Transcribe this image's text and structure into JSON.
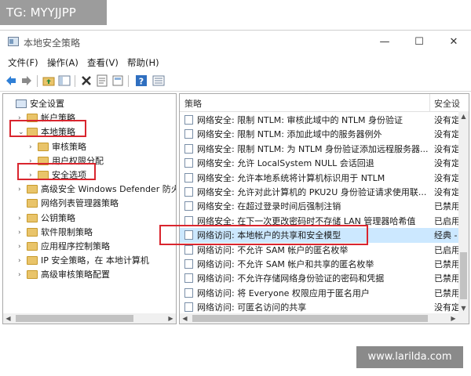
{
  "watermark_top": "TG: MYYJJPP",
  "watermark_bottom": "www.larilda.com",
  "window": {
    "title": "本地安全策略",
    "controls": {
      "minimize": "—",
      "maximize": "☐",
      "close": "✕"
    }
  },
  "menu": {
    "items": [
      {
        "label": "文件(F)"
      },
      {
        "label": "操作(A)"
      },
      {
        "label": "查看(V)"
      },
      {
        "label": "帮助(H)"
      }
    ]
  },
  "toolbar": {
    "icons": [
      "back-icon",
      "forward-icon",
      "folder-up-icon",
      "console-tree-icon",
      "delete-icon",
      "properties-icon",
      "export-icon",
      "help-icon",
      "view-icon"
    ]
  },
  "tree": {
    "items": [
      {
        "label": "安全设置",
        "level": 0,
        "expander": ""
      },
      {
        "label": "帐户策略",
        "level": 1,
        "expander": "›"
      },
      {
        "label": "本地策略",
        "level": 1,
        "expander": "⌄"
      },
      {
        "label": "审核策略",
        "level": 2,
        "expander": "›"
      },
      {
        "label": "用户权限分配",
        "level": 2,
        "expander": "›"
      },
      {
        "label": "安全选项",
        "level": 2,
        "expander": "›"
      },
      {
        "label": "高级安全 Windows Defender 防火墙",
        "level": 1,
        "expander": "›"
      },
      {
        "label": "网络列表管理器策略",
        "level": 1,
        "expander": ""
      },
      {
        "label": "公钥策略",
        "level": 1,
        "expander": "›"
      },
      {
        "label": "软件限制策略",
        "level": 1,
        "expander": "›"
      },
      {
        "label": "应用程序控制策略",
        "level": 1,
        "expander": "›"
      },
      {
        "label": "IP 安全策略，在 本地计算机",
        "level": 1,
        "expander": "›"
      },
      {
        "label": "高级审核策略配置",
        "level": 1,
        "expander": "›"
      }
    ]
  },
  "list": {
    "headers": {
      "policy": "策略",
      "setting": "安全设"
    },
    "rows": [
      {
        "policy": "网络安全: 限制 NTLM: 审核此域中的 NTLM 身份验证",
        "setting": "没有定"
      },
      {
        "policy": "网络安全: 限制 NTLM: 添加此域中的服务器例外",
        "setting": "没有定"
      },
      {
        "policy": "网络安全: 限制 NTLM: 为 NTLM 身份验证添加远程服务器...",
        "setting": "没有定"
      },
      {
        "policy": "网络安全: 允许 LocalSystem NULL 会话回退",
        "setting": "没有定"
      },
      {
        "policy": "网络安全: 允许本地系统将计算机标识用于 NTLM",
        "setting": "没有定"
      },
      {
        "policy": "网络安全: 允许对此计算机的 PKU2U 身份验证请求使用联...",
        "setting": "没有定"
      },
      {
        "policy": "网络安全: 在超过登录时间后强制注销",
        "setting": "已禁用"
      },
      {
        "policy": "网络安全: 在下一次更改密码时不存储 LAN 管理器哈希值",
        "setting": "已启用"
      },
      {
        "policy": "网络访问: 本地帐户的共享和安全模型",
        "setting": "经典 -"
      },
      {
        "policy": "网络访问: 不允许 SAM 帐户的匿名枚举",
        "setting": "已启用"
      },
      {
        "policy": "网络访问: 不允许 SAM 帐户和共享的匿名枚举",
        "setting": "已禁用"
      },
      {
        "policy": "网络访问: 不允许存储网络身份验证的密码和凭据",
        "setting": "已禁用"
      },
      {
        "policy": "网络访问: 将 Everyone 权限应用于匿名用户",
        "setting": "已禁用"
      },
      {
        "policy": "网络访问: 可匿名访问的共享",
        "setting": "没有定"
      }
    ]
  }
}
